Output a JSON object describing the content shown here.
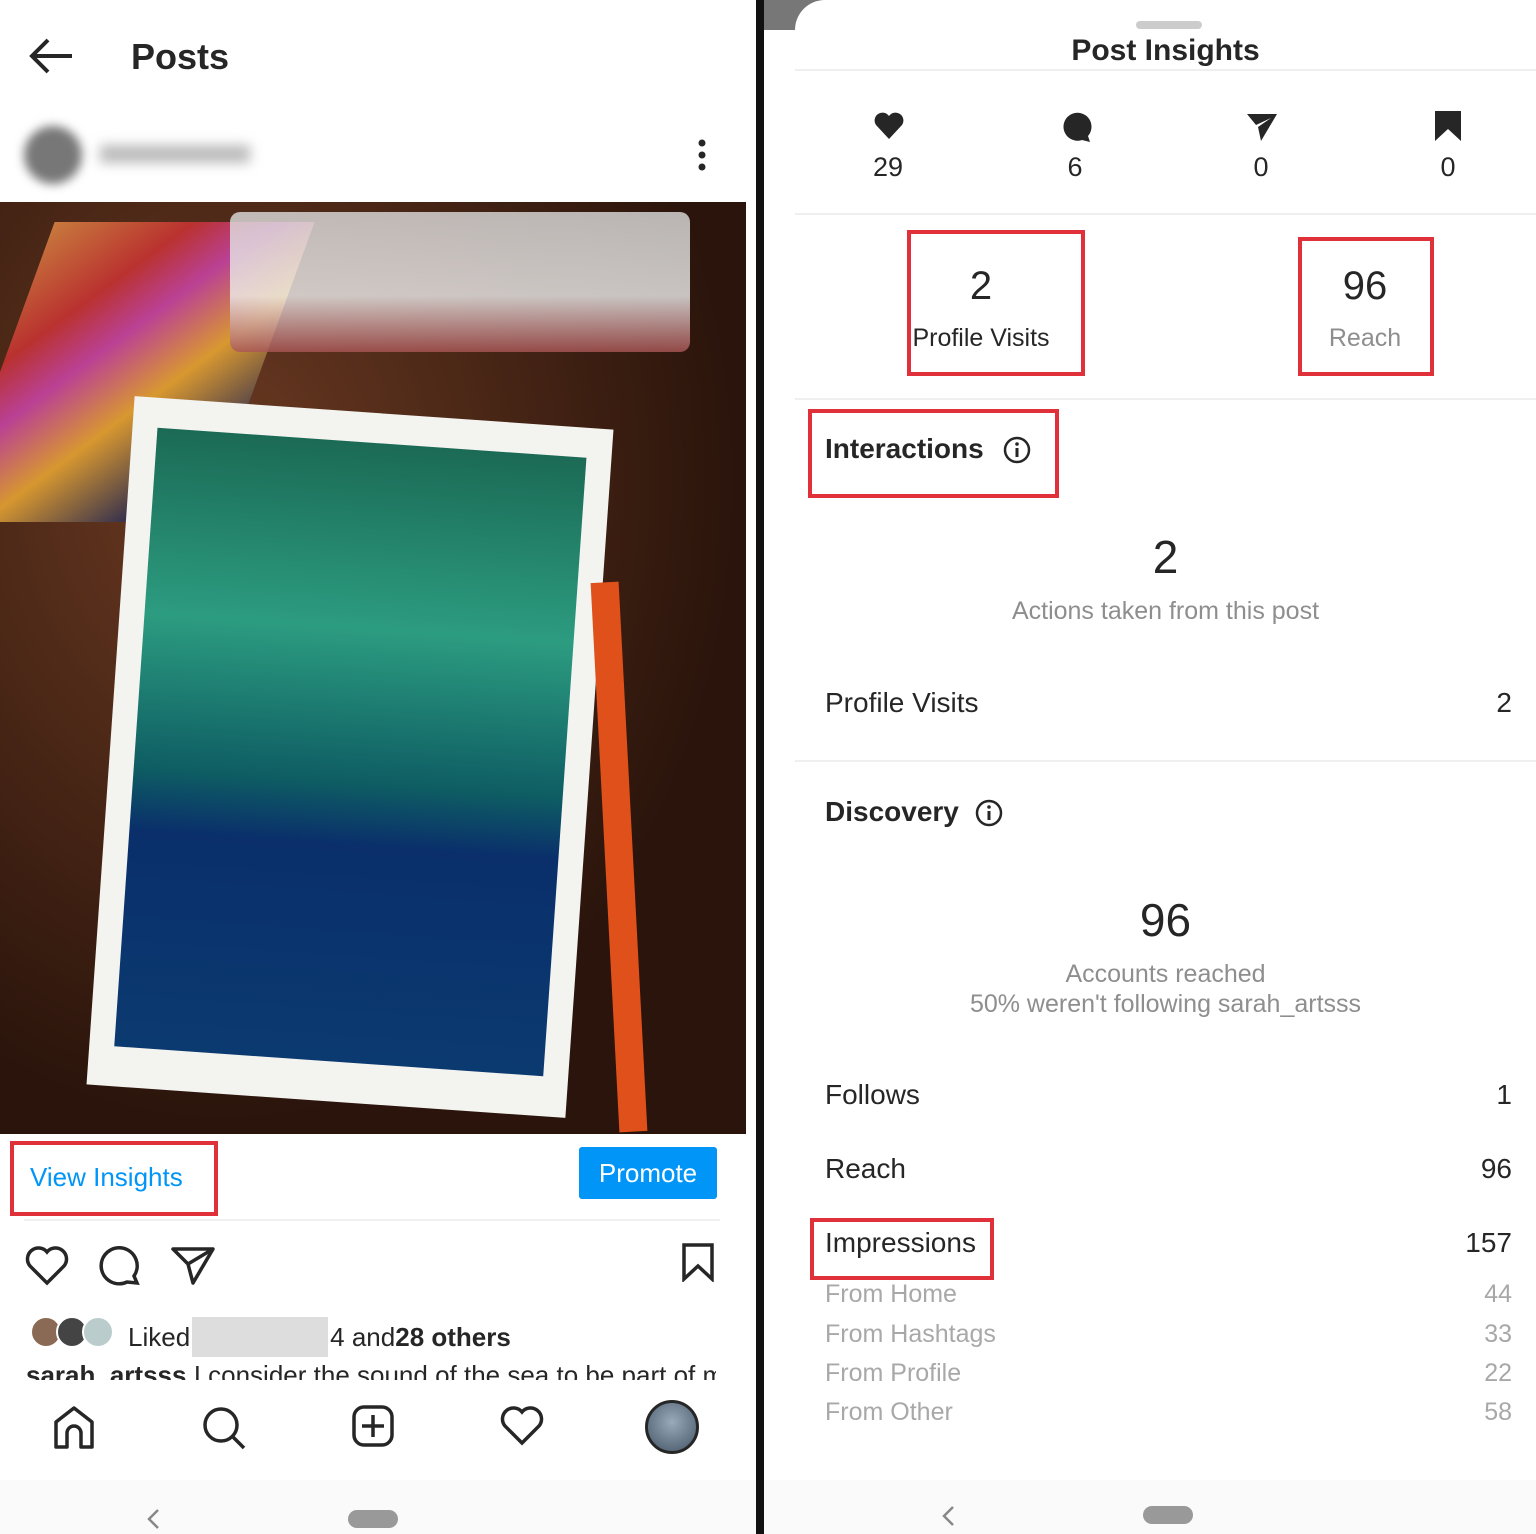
{
  "posts_screen": {
    "title": "Posts",
    "view_insights": "View Insights",
    "promote": "Promote",
    "liked_prefix": "Liked",
    "liked_suffix_plain": "4 and ",
    "liked_suffix_bold": "28 others",
    "caption_user": "sarah_artsss",
    "caption_text": " I consider the sound of the sea to be part of my",
    "accent_color": "#0095f6"
  },
  "insights": {
    "title": "Post Insights",
    "stats": [
      {
        "icon": "heart-icon",
        "value": "29"
      },
      {
        "icon": "comment-icon",
        "value": "6"
      },
      {
        "icon": "share-icon",
        "value": "0"
      },
      {
        "icon": "bookmark-icon",
        "value": "0"
      }
    ],
    "profile_visits": {
      "value": "2",
      "label": "Profile Visits"
    },
    "reach": {
      "value": "96",
      "label": "Reach"
    },
    "interactions": {
      "heading": "Interactions",
      "value": "2",
      "caption": "Actions taken from this post",
      "rows": [
        {
          "label": "Profile Visits",
          "value": "2"
        }
      ]
    },
    "discovery": {
      "heading": "Discovery",
      "value": "96",
      "caption1": "Accounts reached",
      "caption2": "50% weren't following sarah_artsss",
      "rows": [
        {
          "label": "Follows",
          "value": "1"
        },
        {
          "label": "Reach",
          "value": "96"
        },
        {
          "label": "Impressions",
          "value": "157"
        }
      ],
      "subrows": [
        {
          "label": "From Home",
          "value": "44"
        },
        {
          "label": "From Hashtags",
          "value": "33"
        },
        {
          "label": "From Profile",
          "value": "22"
        },
        {
          "label": "From Other",
          "value": "58"
        }
      ]
    },
    "highlight_color": "#e0313b"
  }
}
